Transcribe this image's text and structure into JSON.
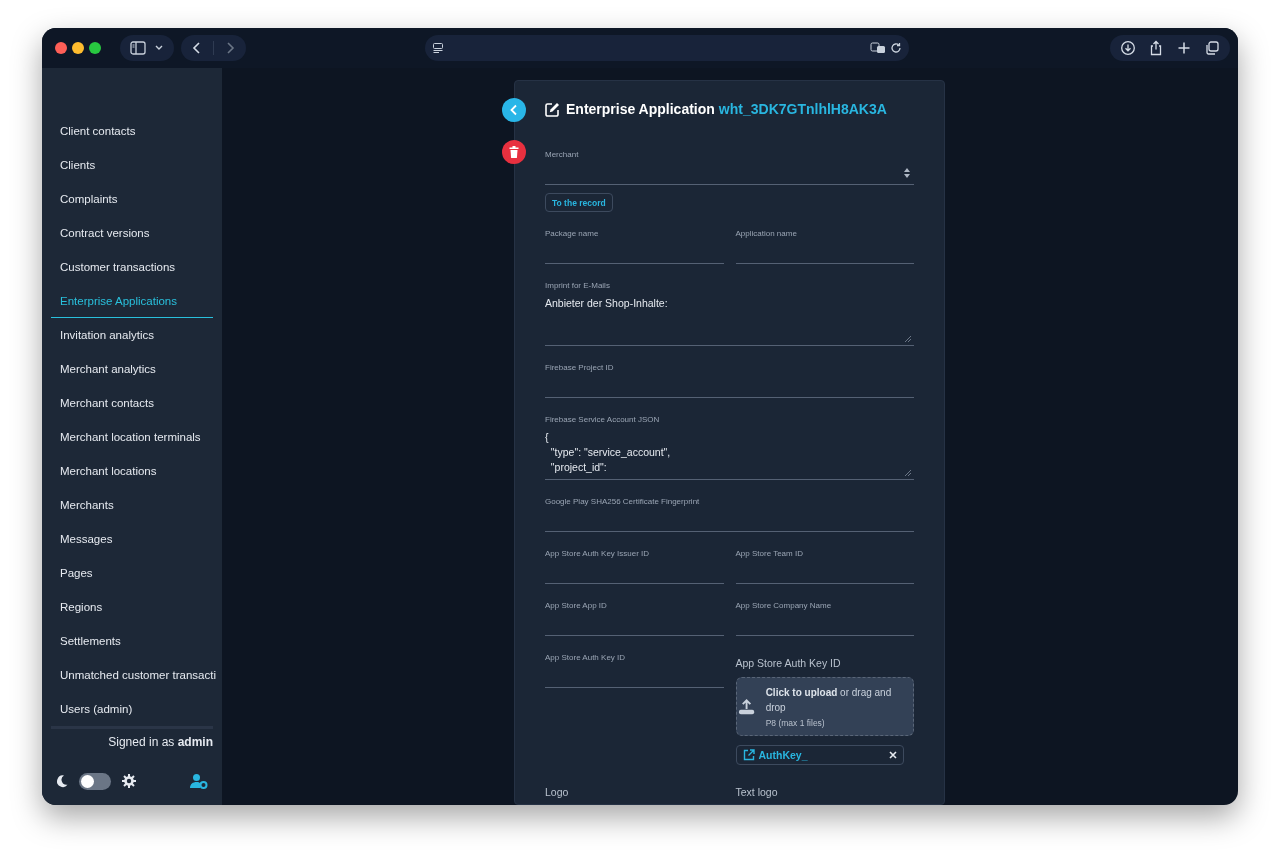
{
  "sidebar": {
    "items": [
      {
        "label": "Client contacts",
        "selected": false
      },
      {
        "label": "Clients",
        "selected": false
      },
      {
        "label": "Complaints",
        "selected": false
      },
      {
        "label": "Contract versions",
        "selected": false
      },
      {
        "label": "Customer transactions",
        "selected": false
      },
      {
        "label": "Enterprise Applications",
        "selected": true
      },
      {
        "label": "Invitation analytics",
        "selected": false
      },
      {
        "label": "Merchant analytics",
        "selected": false
      },
      {
        "label": "Merchant contacts",
        "selected": false
      },
      {
        "label": "Merchant location terminals",
        "selected": false
      },
      {
        "label": "Merchant locations",
        "selected": false
      },
      {
        "label": "Merchants",
        "selected": false
      },
      {
        "label": "Messages",
        "selected": false
      },
      {
        "label": "Pages",
        "selected": false
      },
      {
        "label": "Regions",
        "selected": false
      },
      {
        "label": "Settlements",
        "selected": false
      },
      {
        "label": "Unmatched customer transacti",
        "selected": false
      },
      {
        "label": "Users (admin)",
        "selected": false
      }
    ],
    "signed_in": {
      "prefix": "Signed in as",
      "user": "admin"
    },
    "dark_mode": {
      "on": false
    }
  },
  "record": {
    "title": "Enterprise Application",
    "id": "wht_3DK7GTnlhlH8AK3A"
  },
  "form": {
    "rows": [
      [
        {
          "kind": "select",
          "label": "Merchant",
          "link": "To the record"
        }
      ],
      [
        {
          "kind": "text",
          "label": "Package name"
        },
        {
          "kind": "text",
          "label": "Application name"
        }
      ],
      [
        {
          "kind": "textarea",
          "label": "Imprint for E-Mails",
          "lines": [
            "Anbieter der Shop-Inhalte:"
          ]
        }
      ],
      [
        {
          "kind": "text",
          "label": "Firebase Project ID"
        }
      ],
      [
        {
          "kind": "textarea",
          "label": "Firebase Service Account JSON",
          "lines": [
            "{",
            "  \"type\": \"service_account\",",
            "  \"project_id\":"
          ]
        }
      ],
      [
        {
          "kind": "text",
          "label": "Google Play SHA256 Certificate Fingerprint"
        }
      ],
      [
        {
          "kind": "text",
          "label": "App Store Auth Key Issuer ID"
        },
        {
          "kind": "text",
          "label": "App Store Team ID"
        }
      ],
      [
        {
          "kind": "text",
          "label": "App Store App ID"
        },
        {
          "kind": "text",
          "label": "App Store Company Name"
        }
      ],
      [
        {
          "kind": "text",
          "label": "App Store Auth Key ID"
        },
        {
          "kind": "upload",
          "title": "App Store Auth Key ID",
          "action": "Click to upload",
          "hint": "or drag and drop",
          "formats": "P8 (max 1 files)",
          "files": [
            "AuthKey_"
          ]
        }
      ],
      [
        {
          "kind": "heading",
          "label": "Logo"
        },
        {
          "kind": "heading",
          "label": "Text logo"
        }
      ]
    ]
  }
}
